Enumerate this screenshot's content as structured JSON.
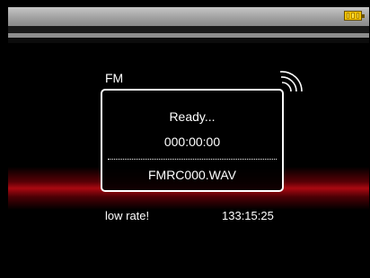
{
  "header": {
    "battery_icon": "battery-icon",
    "battery_color": "#f2c100"
  },
  "radio": {
    "mode": "FM",
    "signal_icon": "signal-icon"
  },
  "recording": {
    "status": "Ready...",
    "elapsed": "000:00:00",
    "filename": "FMRC000.WAV"
  },
  "footer": {
    "warning": "low rate!",
    "remaining": "133:15:25"
  },
  "colors": {
    "accent_red": "#c80a14",
    "background": "#000000",
    "text": "#ffffff"
  }
}
